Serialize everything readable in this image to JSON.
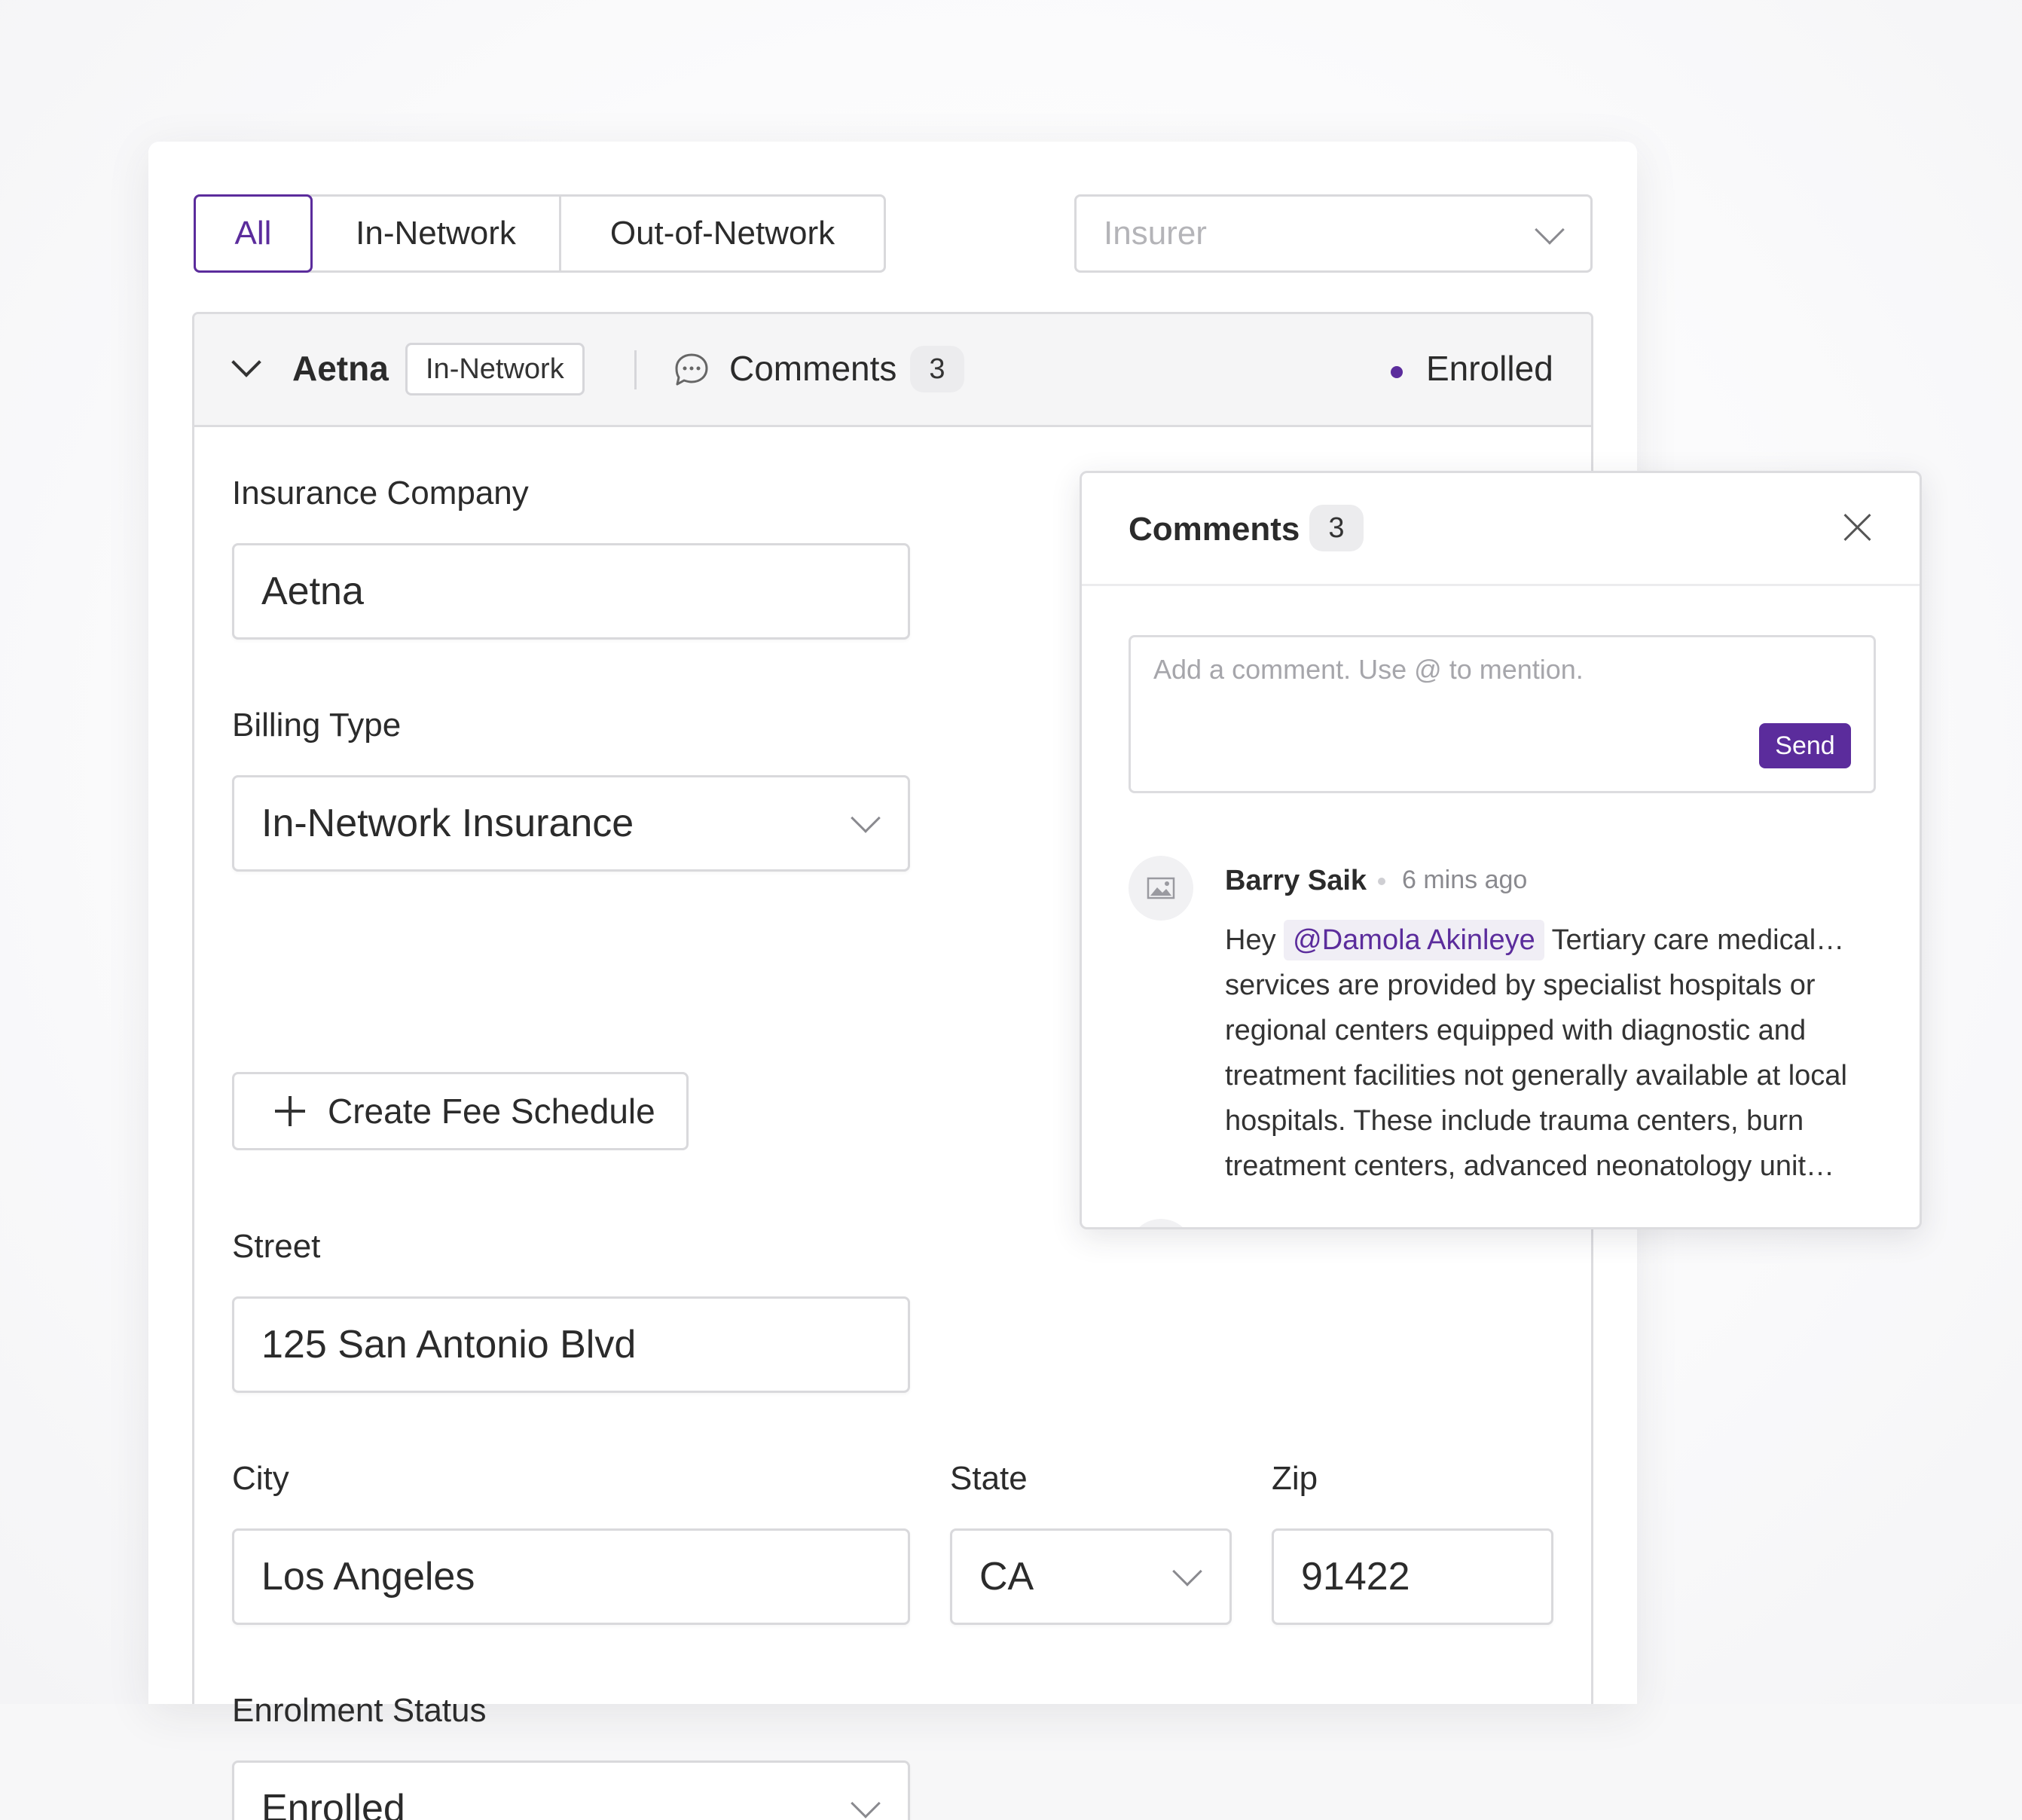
{
  "filters": {
    "tabs": [
      {
        "label": "All",
        "active": true
      },
      {
        "label": "In-Network",
        "active": false
      },
      {
        "label": "Out-of-Network",
        "active": false
      }
    ],
    "insurer_placeholder": "Insurer"
  },
  "section": {
    "title": "Aetna",
    "network_badge": "In-Network",
    "comments_label": "Comments",
    "comments_count": "3",
    "status": "Enrolled"
  },
  "form": {
    "insurance_company": {
      "label": "Insurance Company",
      "value": "Aetna"
    },
    "billing_type": {
      "label": "Billing Type",
      "value": "In-Network Insurance"
    },
    "fee_button": "Create Fee Schedule",
    "street": {
      "label": "Street",
      "value": "125 San Antonio Blvd"
    },
    "city": {
      "label": "City",
      "value": "Los Angeles"
    },
    "state": {
      "label": "State",
      "value": "CA"
    },
    "zip": {
      "label": "Zip",
      "value": "91422"
    },
    "enrolment_status": {
      "label": "Enrolment Status",
      "value": "Enrolled"
    }
  },
  "comments_panel": {
    "title": "Comments",
    "count": "3",
    "input_placeholder": "Add a comment. Use @ to mention.",
    "send_label": "Send",
    "items": [
      {
        "author": "Barry Saik",
        "time": "6 mins ago",
        "prefix": "Hey",
        "mention": "@Damola Akinleye",
        "text": "Tertiary care medical… services are provided by specialist hospitals or regional centers equipped with diagnostic and treatment facilities not generally available at local hospitals. These include trauma centers, burn treatment centers, advanced neonatology unit…"
      }
    ]
  },
  "colors": {
    "accent": "#5b2c9c",
    "border": "#d9d9dc",
    "header_bg": "#f5f5f6"
  }
}
